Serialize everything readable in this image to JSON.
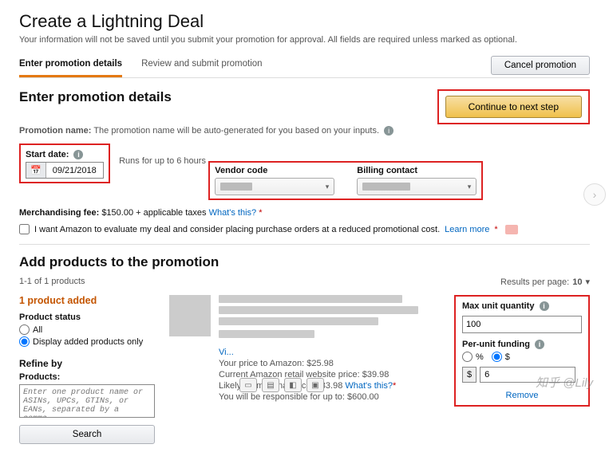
{
  "page": {
    "title": "Create a Lightning Deal",
    "subtitle": "Your information will not be saved until you submit your promotion for approval. All fields are required unless marked as optional."
  },
  "tabs": {
    "enter": "Enter promotion details",
    "review": "Review and submit promotion"
  },
  "buttons": {
    "cancel": "Cancel promotion",
    "continue": "Continue to next step",
    "search": "Search"
  },
  "details": {
    "heading": "Enter promotion details",
    "promo_name_label": "Promotion name:",
    "promo_name_note": "The promotion name will be auto-generated for you based on your inputs.",
    "start_date_label": "Start date:",
    "start_date_value": "09/21/2018",
    "runs_note": "Runs for up to 6 hours",
    "vendor_code_label": "Vendor code",
    "billing_contact_label": "Billing contact",
    "merch_fee_label": "Merchandising fee:",
    "merch_fee_value": "$150.00 + applicable taxes",
    "whats_this": "What's this?",
    "eval_checkbox": "I want Amazon to evaluate my deal and consider placing purchase orders at a reduced promotional cost.",
    "learn_more": "Learn more"
  },
  "products": {
    "heading": "Add products to the promotion",
    "count_text": "1-1 of 1 products",
    "rpp_label": "Results per page:",
    "rpp_value": "10",
    "added_text": "1 product added",
    "status_label": "Product status",
    "status_all": "All",
    "status_added": "Display added products only",
    "refine_by": "Refine by",
    "products_label": "Products:",
    "search_placeholder": "Enter one product name or ASINs, UPCs, GTINs, or EANs, separated by a comma.",
    "vi_link": "Vi...",
    "price_amazon": "Your price to Amazon: $25.98",
    "price_retail": "Current Amazon retail website price: $39.98",
    "price_promo": "Likely promotional price: $33.98",
    "responsible": "You will be responsible for up to: $600.00",
    "max_qty_label": "Max unit quantity",
    "max_qty_value": "100",
    "per_unit_label": "Per-unit funding",
    "percent": "%",
    "dollar": "$",
    "fund_value": "6",
    "remove": "Remove"
  },
  "watermark": "知乎 @Lily"
}
